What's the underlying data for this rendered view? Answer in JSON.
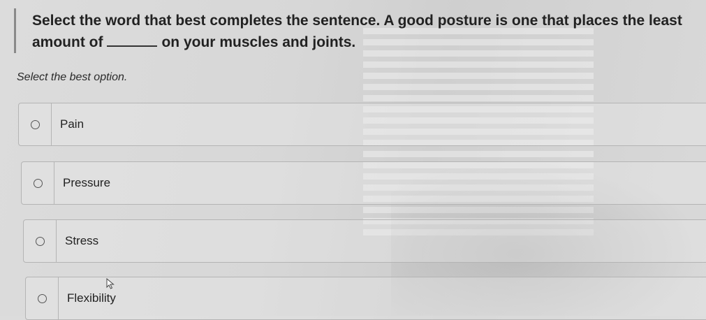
{
  "question": {
    "part1": "Select the word that best completes the sentence. A good posture is one that places the least amount of",
    "part2": "on your muscles and joints."
  },
  "instruction": "Select the best option.",
  "options": [
    {
      "label": "Pain"
    },
    {
      "label": "Pressure"
    },
    {
      "label": "Stress"
    },
    {
      "label": "Flexibility"
    }
  ]
}
